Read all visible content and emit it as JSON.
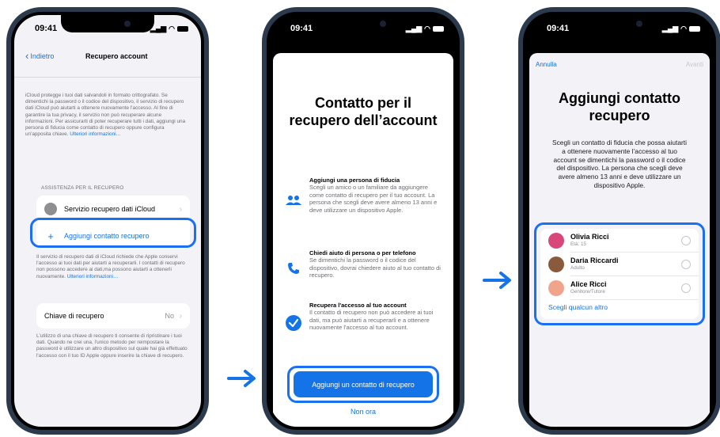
{
  "colors": {
    "accent": "#1473e6",
    "highlight": "#1a6ff2",
    "frame": "#2b3a4c"
  },
  "screen1": {
    "time": "09:41",
    "back_label": "Indietro",
    "title": "Recupero account",
    "intro": "iCloud protegge i tuoi dati salvandoli in formato crittografato. Se dimentichi la password o il codice del dispositivo, il servizio di recupero dati iCloud può aiutarti a ottenere nuovamente l'accesso. Al fine di garantire la tua privacy, il servizio non può recuperare alcune informazioni. Per assicurarti di poter recuperare tutti i dati, aggiungi una persona di fiducia come contatto di recupero oppure configura un'apposita chiave.",
    "intro_link": "Ulteriori informazioni…",
    "section_header": "ASSISTENZA PER IL RECUPERO",
    "row_icloud": "Servizio recupero dati iCloud",
    "row_add": "Aggiungi contatto recupero",
    "footer": "Il servizio di recupero dati di iCloud richiede che Apple conservi l'accesso ai tuoi dati per aiutarti a recuperarli. I contatti di recupero non possono accedere ai dati,ma possono aiutarti a ottenerli nuovamente.",
    "footer_link": "Ulteriori informazioni…",
    "row_key": "Chiave di recupero",
    "row_key_value": "No",
    "key_footer": "L'utilizzo di una chiave di recupero ti consente di ripristinare i tuoi dati. Quando ne crei una, l'unico metodo per reimpostare la password è utilizzare un altro dispositivo sul quale hai già effettuato l'accesso con il tuo ID Apple oppure inserire la chiave di recupero."
  },
  "screen2": {
    "time": "09:41",
    "title": "Contatto per il recupero dell’account",
    "features": [
      {
        "icon": "people-icon",
        "title": "Aggiungi una persona di fiducia",
        "text": "Scegli un amico o un familiare da aggiungere come contatto di recupero per il tuo account. La persona che scegli deve avere almeno 13 anni e deve utilizzare un dispositivo Apple."
      },
      {
        "icon": "phone-icon",
        "title": "Chiedi aiuto di persona o per telefono",
        "text": "Se dimentichi la password o il codice del dispositivo, dovrai chiedere aiuto al tuo contatto di recupero."
      },
      {
        "icon": "checkmark-icon",
        "title": "Recupera l'accesso al tuo account",
        "text": "Il contatto di recupero non può accedere ai tuoi dati, ma può aiutarti a recuperarli e a ottenere nuovamente l'accesso al tuo account."
      }
    ],
    "primary_button": "Aggiungi un contatto di recupero",
    "secondary_button": "Non ora"
  },
  "screen3": {
    "time": "09:41",
    "cancel": "Annulla",
    "next": "Avanti",
    "title": "Aggiungi contatto recupero",
    "description": "Scegli un contatto di fiducia che possa aiutarti a ottenere nuovamente l’accesso al tuo account se dimentichi la password o il codice del dispositivo. La persona che scegli deve avere almeno 13 anni e deve utilizzare un dispositivo Apple.",
    "contacts": [
      {
        "name": "Olivia Ricci",
        "detail": "Età: 15",
        "color": "#d9467a"
      },
      {
        "name": "Daria Riccardi",
        "detail": "Adulto",
        "color": "#8a5a3c"
      },
      {
        "name": "Alice Ricci",
        "detail": "Genitore/Tutore",
        "color": "#f0a48c"
      }
    ],
    "choose_other": "Scegli qualcun altro"
  }
}
